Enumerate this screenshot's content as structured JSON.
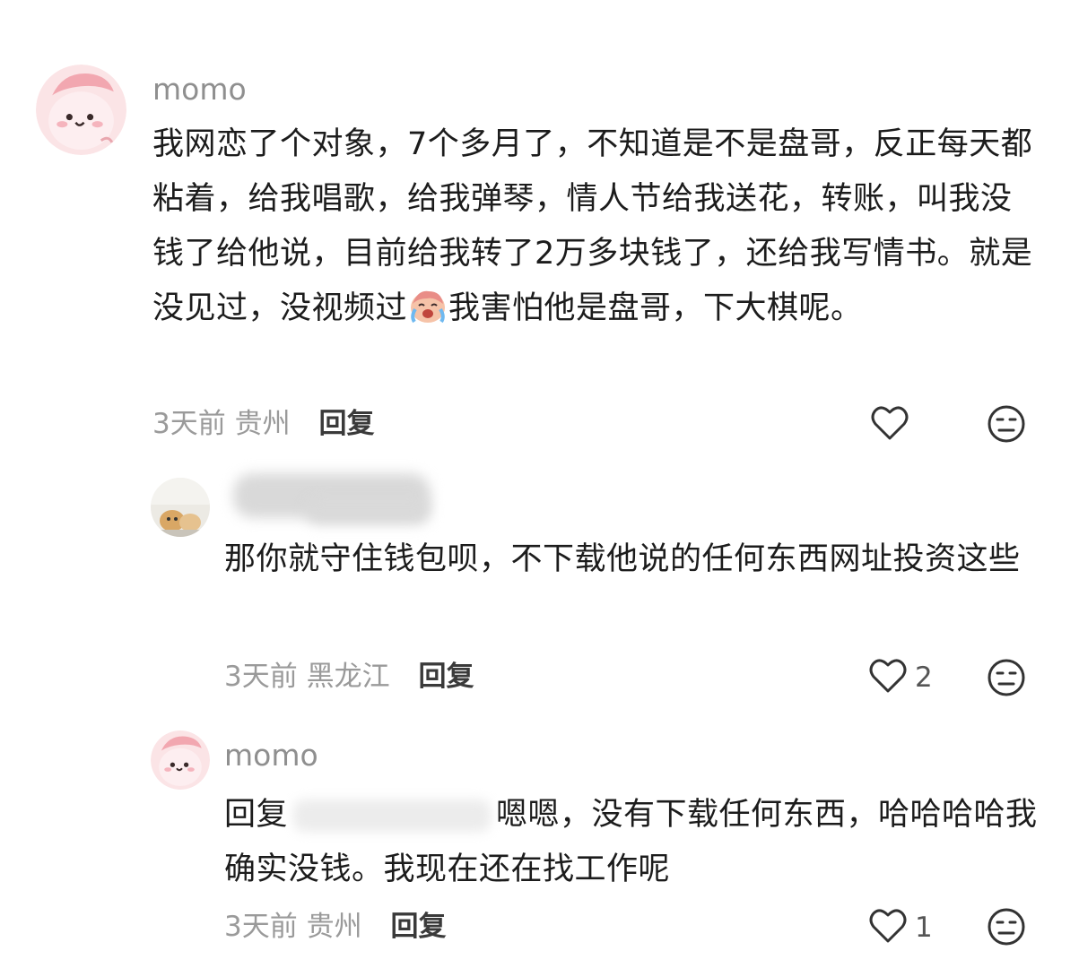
{
  "comments": [
    {
      "username": "momo",
      "text_before_emoji": "我网恋了个对象，7个多月了，不知道是不是盘哥，反正每天都粘着，给我唱歌，给我弹琴，情人节给我送花，转账，叫我没钱了给他说，目前给我转了2万多块钱了，还给我写情书。就是没见过，没视频过",
      "emoji": "crying-face-emoji",
      "text_after_emoji": "我害怕他是盘哥，下大棋呢。",
      "time": "3天前",
      "location": "贵州",
      "reply_label": "回复",
      "like_count": ""
    },
    {
      "username": "",
      "text": "那你就守住钱包呗，不下载他说的任何东西网址投资这些",
      "time": "3天前",
      "location": "黑龙江",
      "reply_label": "回复",
      "like_count": "2"
    },
    {
      "username": "momo",
      "reply_prefix": "回复",
      "text": "嗯嗯，没有下载任何东西，哈哈哈哈我确实没钱。我现在还在找工作呢",
      "time": "3天前",
      "location": "贵州",
      "reply_label": "回复",
      "like_count": "1"
    }
  ],
  "icons": {
    "like": "heart-outline-icon",
    "dislike": "meh-face-icon"
  },
  "colors": {
    "meta_gray": "#9a9a9a",
    "username_gray": "#8f8f8f",
    "avatar_pink": "#f7d3d6"
  }
}
